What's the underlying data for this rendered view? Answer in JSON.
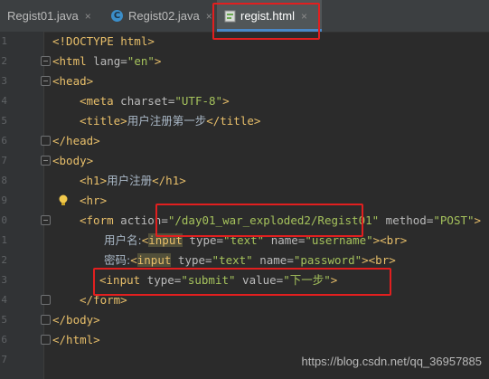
{
  "tabs": [
    {
      "label": "Regist01.java",
      "icon": "java-class-icon",
      "active": false
    },
    {
      "label": "Regist02.java",
      "icon": "java-class-icon",
      "active": false
    },
    {
      "label": "regist.html",
      "icon": "html-file-icon",
      "active": true
    }
  ],
  "tab_close": "×",
  "gutter": {
    "line_numbers": [
      "1",
      "2",
      "3",
      "4",
      "5",
      "6",
      "7",
      "8",
      "9",
      "0",
      "1",
      "2",
      "3",
      "4",
      "5",
      "6",
      "7"
    ]
  },
  "code": {
    "doctype": "<!DOCTYPE html>",
    "l2_open": "<html",
    "l2_attr": " lang=",
    "l2_val": "\"en\"",
    "l2_close": ">",
    "l3": "<head>",
    "l4_open": "<meta",
    "l4_attr": " charset=",
    "l4_val": "\"UTF-8\"",
    "l4_close": ">",
    "l5_open": "<title>",
    "l5_text": "用户注册第一步",
    "l5_close": "</title>",
    "l6": "</head>",
    "l7": "<body>",
    "l8_open": "<h1>",
    "l8_text": "用户注册",
    "l8_close": "</h1>",
    "l9": "<hr>",
    "l10_open": "<form",
    "l10_attr1": " action=",
    "l10_val1": "\"/day01_war_exploded2/Regist01\"",
    "l10_attr2": " method=",
    "l10_val2": "\"POST\"",
    "l10_close": ">",
    "l11_text": "用户名:",
    "l11_open": "<",
    "l11_tag": "input",
    "l11_attr1": " type=",
    "l11_val1": "\"text\"",
    "l11_attr2": " name=",
    "l11_val2": "\"username\"",
    "l11_close": "><br>",
    "l12_text": "密码:",
    "l12_open": "<",
    "l12_tag": "input",
    "l12_attr1": " type=",
    "l12_val1": "\"text\"",
    "l12_attr2": " name=",
    "l12_val2": "\"password\"",
    "l12_close": "><br>",
    "l13_open": "<input",
    "l13_attr1": " type=",
    "l13_val1": "\"submit\"",
    "l13_attr2": " value=",
    "l13_val2": "\"下一步\"",
    "l13_close": ">",
    "l14": "</form>",
    "l15": "</body>",
    "l16": "</html>"
  },
  "watermark": "https://blog.csdn.net/qq_36957885",
  "colors": {
    "tag": "#e8bf6a",
    "attribute": "#bababa",
    "value": "#a5c25c",
    "highlight_box": "#e11f1f"
  }
}
